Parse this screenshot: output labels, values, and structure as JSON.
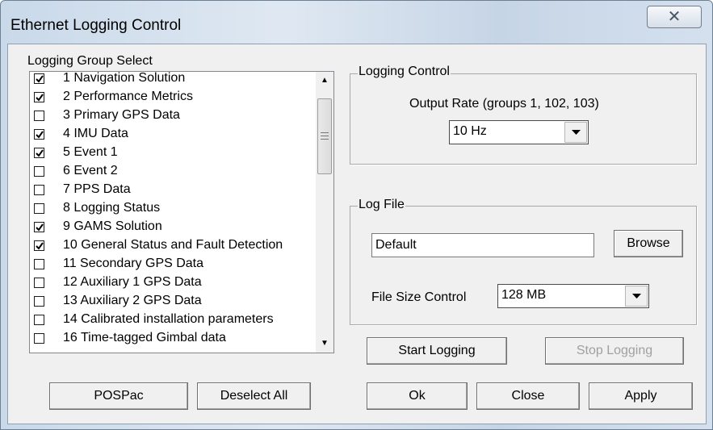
{
  "window": {
    "title": "Ethernet Logging Control",
    "close_glyph": "✕"
  },
  "logging_group_select": {
    "label": "Logging Group Select",
    "items": [
      {
        "label": "1 Navigation Solution",
        "checked": true
      },
      {
        "label": "2 Performance Metrics",
        "checked": true
      },
      {
        "label": "3 Primary GPS Data",
        "checked": false
      },
      {
        "label": "4 IMU Data",
        "checked": true
      },
      {
        "label": "5 Event 1",
        "checked": true
      },
      {
        "label": "6 Event 2",
        "checked": false
      },
      {
        "label": "7 PPS Data",
        "checked": false
      },
      {
        "label": "8 Logging Status",
        "checked": false
      },
      {
        "label": "9 GAMS Solution",
        "checked": true
      },
      {
        "label": "10 General Status and Fault Detection",
        "checked": true
      },
      {
        "label": "11 Secondary GPS Data",
        "checked": false
      },
      {
        "label": "12 Auxiliary 1 GPS Data",
        "checked": false
      },
      {
        "label": "13 Auxiliary 2 GPS Data",
        "checked": false
      },
      {
        "label": "14 Calibrated installation parameters",
        "checked": false
      },
      {
        "label": "16 Time-tagged Gimbal data",
        "checked": false
      }
    ]
  },
  "logging_control": {
    "title": "Logging Control",
    "output_rate_label": "Output Rate (groups 1, 102, 103)",
    "output_rate_value": "10 Hz"
  },
  "log_file": {
    "title": "Log File",
    "filename_value": "Default",
    "browse_label": "Browse",
    "file_size_label": "File Size Control",
    "file_size_value": "128 MB"
  },
  "buttons": {
    "start_logging": "Start Logging",
    "stop_logging": "Stop Logging",
    "pospac": "POSPac",
    "deselect_all": "Deselect All",
    "ok": "Ok",
    "close": "Close",
    "apply": "Apply"
  }
}
